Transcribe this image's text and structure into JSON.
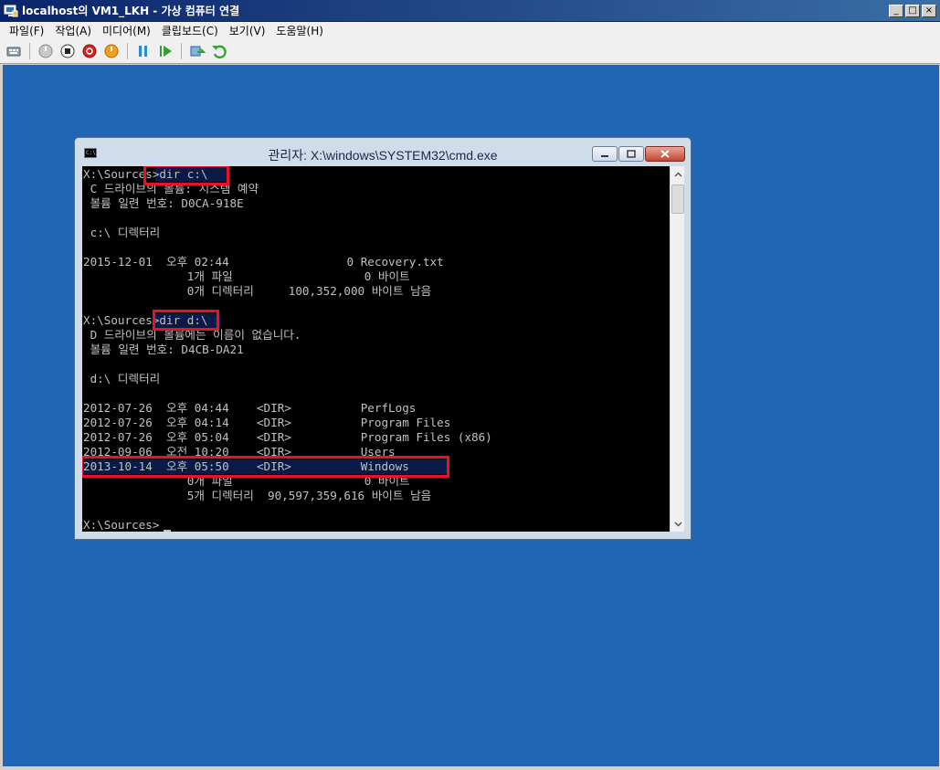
{
  "window": {
    "title": "localhost의 VM1_LKH - 가상 컴퓨터 연결",
    "minimize": "_",
    "maximize": "□",
    "close": "×"
  },
  "menu": [
    "파일(F)",
    "작업(A)",
    "미디어(M)",
    "클립보드(C)",
    "보기(V)",
    "도움말(H)"
  ],
  "toolbar_icons": [
    "ctrl-alt-del-icon",
    "start-icon",
    "turn-off-icon",
    "shut-down-icon",
    "power-icon",
    "pause-icon",
    "resume-icon",
    "snapshot-icon",
    "revert-icon"
  ],
  "cmd": {
    "title": "관리자: X:\\windows\\SYSTEM32\\cmd.exe",
    "icon_text": "C:\\",
    "lines": [
      "X:\\Sources>dir c:\\",
      " C 드라이브의 볼륨: 시스템 예약",
      " 볼륨 일련 번호: D0CA-918E",
      "",
      " c:\\ 디렉터리",
      "",
      "2015-12-01  오후 02:44                 0 Recovery.txt",
      "               1개 파일                   0 바이트",
      "               0개 디렉터리     100,352,000 바이트 남음",
      "",
      "X:\\Sources>dir d:\\",
      " D 드라이브의 볼륨에는 이름이 없습니다.",
      " 볼륨 일련 번호: D4CB-DA21",
      "",
      " d:\\ 디렉터리",
      "",
      "2012-07-26  오후 04:44    <DIR>          PerfLogs",
      "2012-07-26  오후 04:14    <DIR>          Program Files",
      "2012-07-26  오후 05:04    <DIR>          Program Files (x86)",
      "2012-09-06  오전 10:20    <DIR>          Users",
      "2013-10-14  오후 05:50    <DIR>          Windows",
      "               0개 파일                   0 바이트",
      "               5개 디렉터리  90,597,359,616 바이트 남음",
      "",
      "X:\\Sources>"
    ]
  },
  "colors": {
    "desktop": "#2165b5",
    "console_bg": "#000000",
    "console_fg": "#c0c0c0",
    "highlight": "#e8102a"
  }
}
